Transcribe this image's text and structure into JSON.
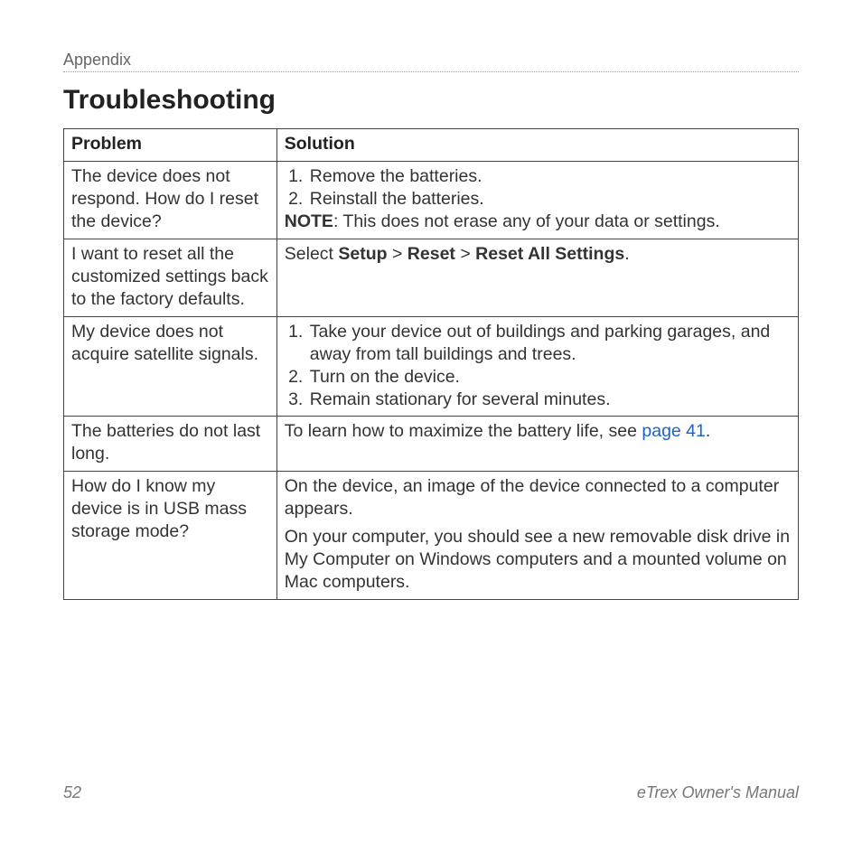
{
  "header": {
    "section": "Appendix",
    "title": "Troubleshooting"
  },
  "table": {
    "headers": {
      "problem": "Problem",
      "solution": "Solution"
    },
    "rows": [
      {
        "problem": "The device does not respond. How do I reset the device?",
        "steps": [
          "Remove the batteries.",
          "Reinstall the batteries."
        ],
        "note_label": "NOTE",
        "note_text": ": This does not erase any of your data or settings."
      },
      {
        "problem": "I want to reset all the customized settings back to the factory defaults.",
        "solution_prefix": "Select ",
        "path_sep": " > ",
        "path": [
          "Setup",
          "Reset",
          "Reset All Settings"
        ],
        "solution_suffix": "."
      },
      {
        "problem": "My device does not acquire satellite signals.",
        "steps": [
          "Take your device out of buildings and parking garages, and away from tall buildings and trees.",
          "Turn on the device.",
          "Remain stationary for several minutes."
        ]
      },
      {
        "problem": "The batteries do not last long.",
        "solution_prefix": "To learn how to maximize the battery life, see ",
        "link_text": "page 41",
        "solution_suffix": "."
      },
      {
        "problem": "How do I know my device is in USB mass storage mode?",
        "paragraphs": [
          "On the device, an image of the device connected to a computer appears.",
          "On your computer, you should see a new removable disk drive in My Computer on Windows computers and a mounted volume on Mac computers."
        ]
      }
    ]
  },
  "footer": {
    "page_number": "52",
    "manual_title": "eTrex Owner's Manual"
  }
}
